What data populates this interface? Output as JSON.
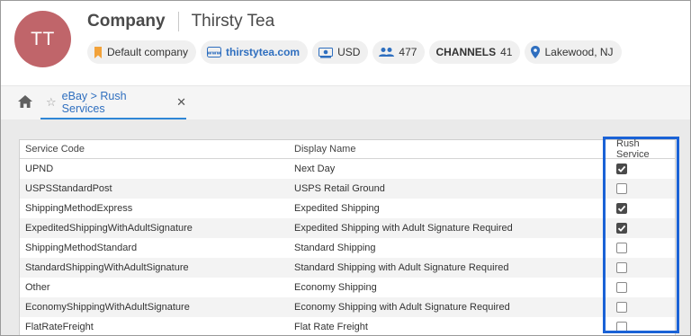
{
  "header": {
    "avatar_initials": "TT",
    "avatar_color": "#c0656a",
    "company_label": "Company",
    "company_name": "Thirsty Tea",
    "chips": {
      "default_company": {
        "icon": "bookmark-icon",
        "label": "Default company"
      },
      "website": {
        "icon": "www-icon",
        "label": "thirstytea.com"
      },
      "currency": {
        "icon": "currency-icon",
        "label": "USD"
      },
      "users": {
        "icon": "users-icon",
        "label": "477"
      },
      "channels": {
        "label": "CHANNELS",
        "count": "41"
      },
      "location": {
        "icon": "location-pin-icon",
        "label": "Lakewood, NJ"
      }
    }
  },
  "tabs": {
    "home_icon": "home-icon",
    "active_tab": {
      "label": "eBay > Rush Services",
      "star_icon": "star-icon",
      "close_icon": "close-icon"
    }
  },
  "table": {
    "columns": [
      "Service Code",
      "Display Name",
      "Rush Service"
    ],
    "rows": [
      {
        "code": "UPND",
        "display": "Next Day",
        "rush": true
      },
      {
        "code": "USPSStandardPost",
        "display": "USPS Retail Ground",
        "rush": false
      },
      {
        "code": "ShippingMethodExpress",
        "display": "Expedited Shipping",
        "rush": true
      },
      {
        "code": "ExpeditedShippingWithAdultSignature",
        "display": "Expedited Shipping with Adult Signature Required",
        "rush": true
      },
      {
        "code": "ShippingMethodStandard",
        "display": "Standard Shipping",
        "rush": false
      },
      {
        "code": "StandardShippingWithAdultSignature",
        "display": "Standard Shipping with Adult Signature Required",
        "rush": false
      },
      {
        "code": "Other",
        "display": "Economy Shipping",
        "rush": false
      },
      {
        "code": "EconomyShippingWithAdultSignature",
        "display": "Economy Shipping with Adult Signature Required",
        "rush": false
      },
      {
        "code": "FlatRateFreight",
        "display": "Flat Rate Freight",
        "rush": false
      }
    ]
  },
  "colors": {
    "accent": "#2f86d6",
    "highlight_border": "#1a62d6",
    "link": "#2f6fbf",
    "chip_bookmark": "#f2a23a"
  }
}
